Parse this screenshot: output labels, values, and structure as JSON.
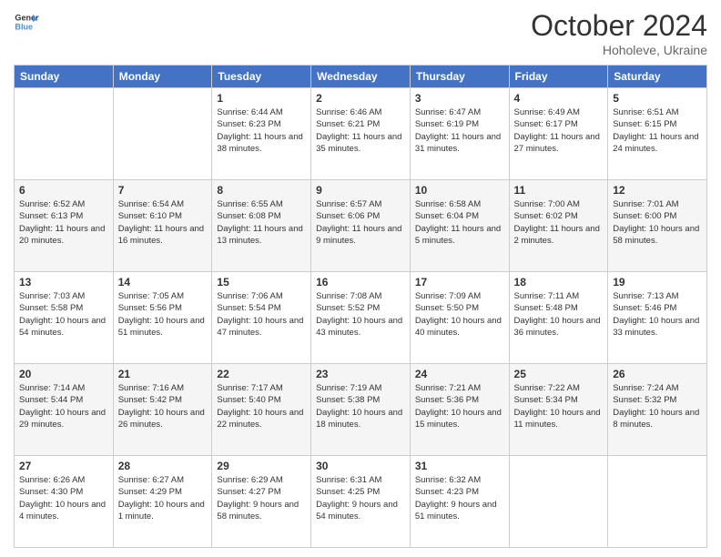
{
  "header": {
    "logo_line1": "General",
    "logo_line2": "Blue",
    "month": "October 2024",
    "location": "Hoholeve, Ukraine"
  },
  "days_of_week": [
    "Sunday",
    "Monday",
    "Tuesday",
    "Wednesday",
    "Thursday",
    "Friday",
    "Saturday"
  ],
  "weeks": [
    [
      null,
      null,
      {
        "day": 1,
        "sunrise": "6:44 AM",
        "sunset": "6:23 PM",
        "daylight": "11 hours and 38 minutes."
      },
      {
        "day": 2,
        "sunrise": "6:46 AM",
        "sunset": "6:21 PM",
        "daylight": "11 hours and 35 minutes."
      },
      {
        "day": 3,
        "sunrise": "6:47 AM",
        "sunset": "6:19 PM",
        "daylight": "11 hours and 31 minutes."
      },
      {
        "day": 4,
        "sunrise": "6:49 AM",
        "sunset": "6:17 PM",
        "daylight": "11 hours and 27 minutes."
      },
      {
        "day": 5,
        "sunrise": "6:51 AM",
        "sunset": "6:15 PM",
        "daylight": "11 hours and 24 minutes."
      }
    ],
    [
      {
        "day": 6,
        "sunrise": "6:52 AM",
        "sunset": "6:13 PM",
        "daylight": "11 hours and 20 minutes."
      },
      {
        "day": 7,
        "sunrise": "6:54 AM",
        "sunset": "6:10 PM",
        "daylight": "11 hours and 16 minutes."
      },
      {
        "day": 8,
        "sunrise": "6:55 AM",
        "sunset": "6:08 PM",
        "daylight": "11 hours and 13 minutes."
      },
      {
        "day": 9,
        "sunrise": "6:57 AM",
        "sunset": "6:06 PM",
        "daylight": "11 hours and 9 minutes."
      },
      {
        "day": 10,
        "sunrise": "6:58 AM",
        "sunset": "6:04 PM",
        "daylight": "11 hours and 5 minutes."
      },
      {
        "day": 11,
        "sunrise": "7:00 AM",
        "sunset": "6:02 PM",
        "daylight": "11 hours and 2 minutes."
      },
      {
        "day": 12,
        "sunrise": "7:01 AM",
        "sunset": "6:00 PM",
        "daylight": "10 hours and 58 minutes."
      }
    ],
    [
      {
        "day": 13,
        "sunrise": "7:03 AM",
        "sunset": "5:58 PM",
        "daylight": "10 hours and 54 minutes."
      },
      {
        "day": 14,
        "sunrise": "7:05 AM",
        "sunset": "5:56 PM",
        "daylight": "10 hours and 51 minutes."
      },
      {
        "day": 15,
        "sunrise": "7:06 AM",
        "sunset": "5:54 PM",
        "daylight": "10 hours and 47 minutes."
      },
      {
        "day": 16,
        "sunrise": "7:08 AM",
        "sunset": "5:52 PM",
        "daylight": "10 hours and 43 minutes."
      },
      {
        "day": 17,
        "sunrise": "7:09 AM",
        "sunset": "5:50 PM",
        "daylight": "10 hours and 40 minutes."
      },
      {
        "day": 18,
        "sunrise": "7:11 AM",
        "sunset": "5:48 PM",
        "daylight": "10 hours and 36 minutes."
      },
      {
        "day": 19,
        "sunrise": "7:13 AM",
        "sunset": "5:46 PM",
        "daylight": "10 hours and 33 minutes."
      }
    ],
    [
      {
        "day": 20,
        "sunrise": "7:14 AM",
        "sunset": "5:44 PM",
        "daylight": "10 hours and 29 minutes."
      },
      {
        "day": 21,
        "sunrise": "7:16 AM",
        "sunset": "5:42 PM",
        "daylight": "10 hours and 26 minutes."
      },
      {
        "day": 22,
        "sunrise": "7:17 AM",
        "sunset": "5:40 PM",
        "daylight": "10 hours and 22 minutes."
      },
      {
        "day": 23,
        "sunrise": "7:19 AM",
        "sunset": "5:38 PM",
        "daylight": "10 hours and 18 minutes."
      },
      {
        "day": 24,
        "sunrise": "7:21 AM",
        "sunset": "5:36 PM",
        "daylight": "10 hours and 15 minutes."
      },
      {
        "day": 25,
        "sunrise": "7:22 AM",
        "sunset": "5:34 PM",
        "daylight": "10 hours and 11 minutes."
      },
      {
        "day": 26,
        "sunrise": "7:24 AM",
        "sunset": "5:32 PM",
        "daylight": "10 hours and 8 minutes."
      }
    ],
    [
      {
        "day": 27,
        "sunrise": "6:26 AM",
        "sunset": "4:30 PM",
        "daylight": "10 hours and 4 minutes."
      },
      {
        "day": 28,
        "sunrise": "6:27 AM",
        "sunset": "4:29 PM",
        "daylight": "10 hours and 1 minute."
      },
      {
        "day": 29,
        "sunrise": "6:29 AM",
        "sunset": "4:27 PM",
        "daylight": "9 hours and 58 minutes."
      },
      {
        "day": 30,
        "sunrise": "6:31 AM",
        "sunset": "4:25 PM",
        "daylight": "9 hours and 54 minutes."
      },
      {
        "day": 31,
        "sunrise": "6:32 AM",
        "sunset": "4:23 PM",
        "daylight": "9 hours and 51 minutes."
      },
      null,
      null
    ]
  ],
  "labels": {
    "sunrise": "Sunrise:",
    "sunset": "Sunset:",
    "daylight": "Daylight:"
  }
}
